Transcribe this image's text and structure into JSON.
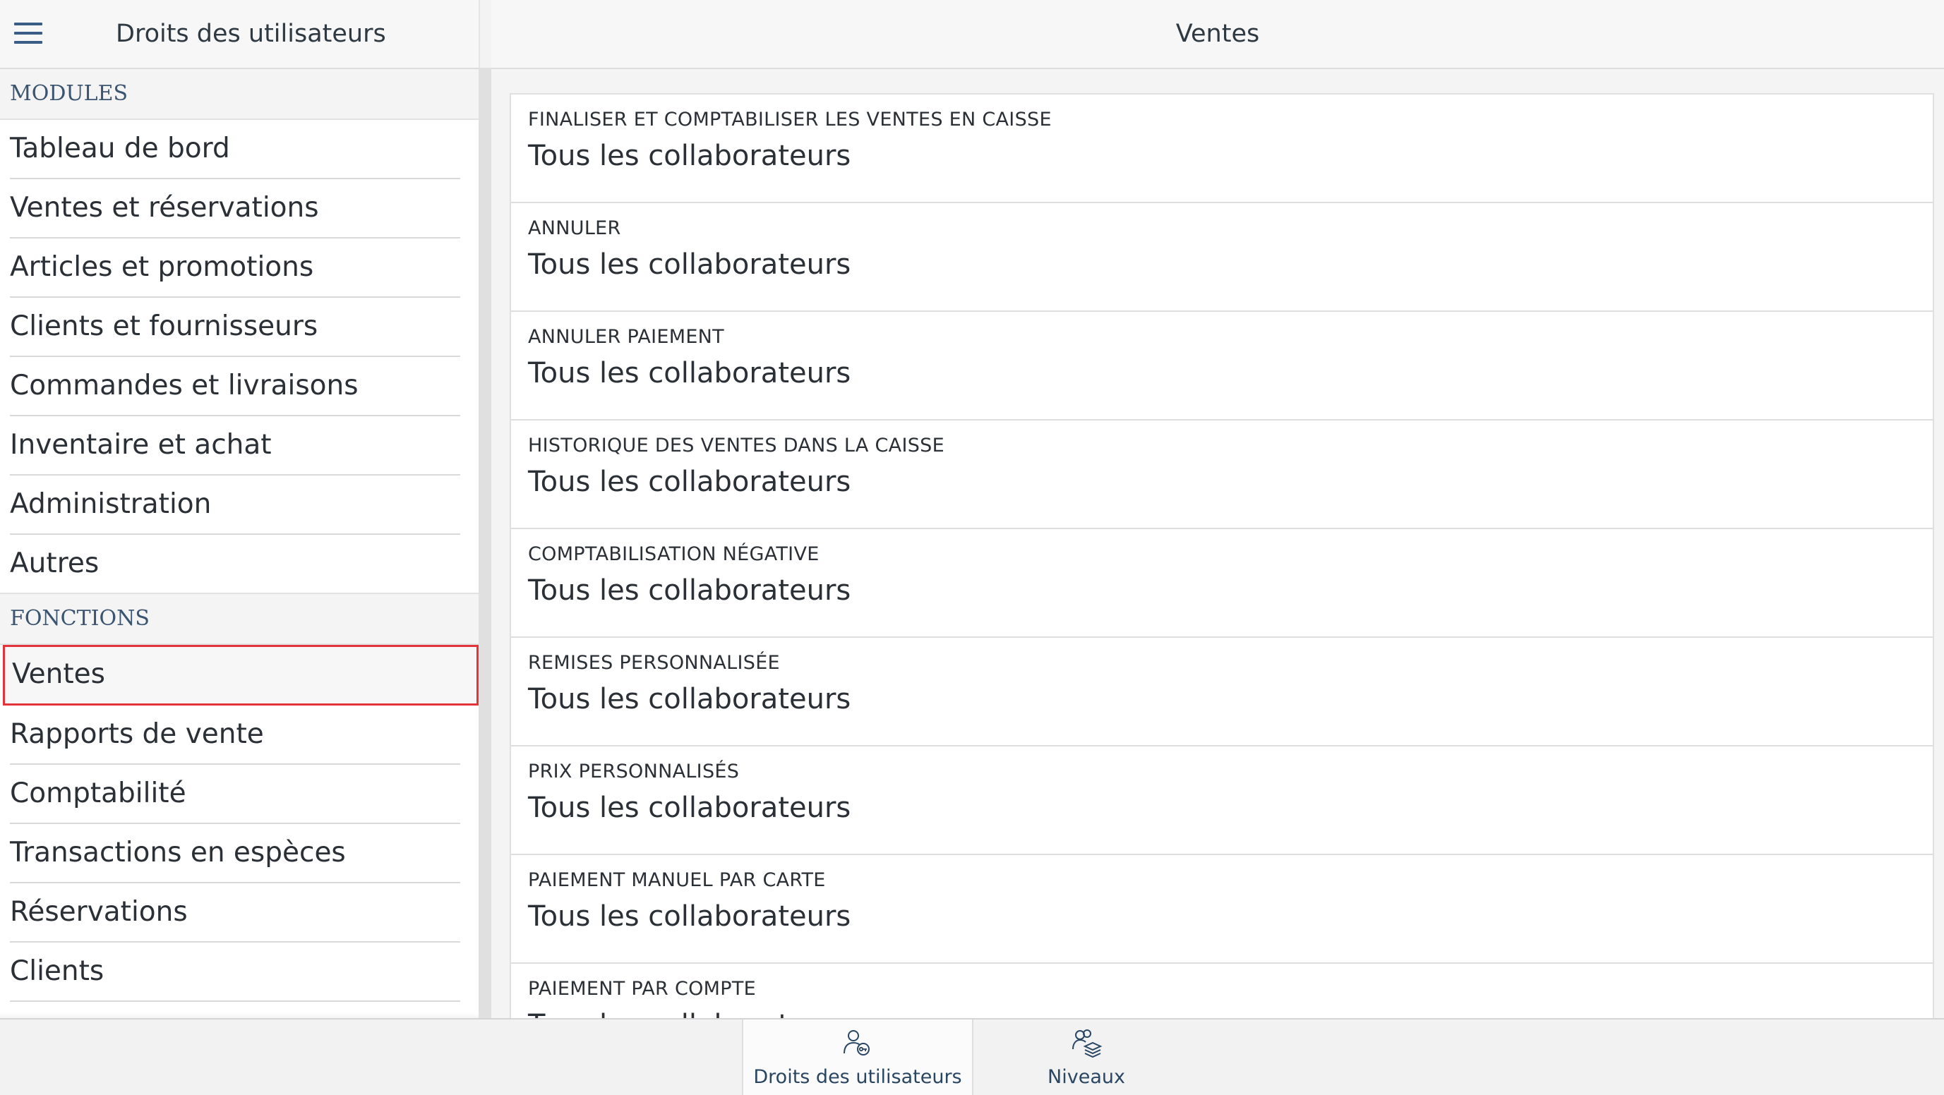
{
  "left_header": {
    "title": "Droits des utilisateurs"
  },
  "modules": {
    "heading": "MODULES",
    "items": [
      {
        "label": "Tableau de bord"
      },
      {
        "label": "Ventes et réservations"
      },
      {
        "label": "Articles et promotions"
      },
      {
        "label": "Clients et fournisseurs"
      },
      {
        "label": "Commandes et livraisons"
      },
      {
        "label": "Inventaire et achat"
      },
      {
        "label": "Administration"
      },
      {
        "label": "Autres"
      }
    ]
  },
  "fonctions": {
    "heading": "FONCTIONS",
    "items": [
      {
        "label": "Ventes",
        "selected": true
      },
      {
        "label": "Rapports de vente"
      },
      {
        "label": "Comptabilité"
      },
      {
        "label": "Transactions en espèces"
      },
      {
        "label": "Réservations"
      },
      {
        "label": "Clients"
      }
    ]
  },
  "right_header": {
    "title": "Ventes"
  },
  "rights": [
    {
      "label": "FINALISER ET COMPTABILISER LES VENTES EN CAISSE",
      "value": "Tous les collaborateurs"
    },
    {
      "label": "ANNULER",
      "value": "Tous les collaborateurs"
    },
    {
      "label": "ANNULER PAIEMENT",
      "value": "Tous les collaborateurs"
    },
    {
      "label": "HISTORIQUE DES VENTES DANS LA CAISSE",
      "value": "Tous les collaborateurs"
    },
    {
      "label": "COMPTABILISATION NÉGATIVE",
      "value": "Tous les collaborateurs"
    },
    {
      "label": "REMISES PERSONNALISÉE",
      "value": "Tous les collaborateurs"
    },
    {
      "label": "PRIX PERSONNALISÉS",
      "value": "Tous les collaborateurs"
    },
    {
      "label": "PAIEMENT MANUEL PAR CARTE",
      "value": "Tous les collaborateurs"
    },
    {
      "label": "PAIEMENT PAR COMPTE",
      "value": "Tous les collaborateurs"
    }
  ],
  "bottom_tabs": [
    {
      "label": "Droits des utilisateurs",
      "icon": "user-key-icon",
      "active": true
    },
    {
      "label": "Niveaux",
      "icon": "users-layers-icon",
      "active": false
    }
  ],
  "colors": {
    "accent": "#3a5d86",
    "selection_outline": "#e3333b",
    "section_heading": "#3b5470"
  }
}
